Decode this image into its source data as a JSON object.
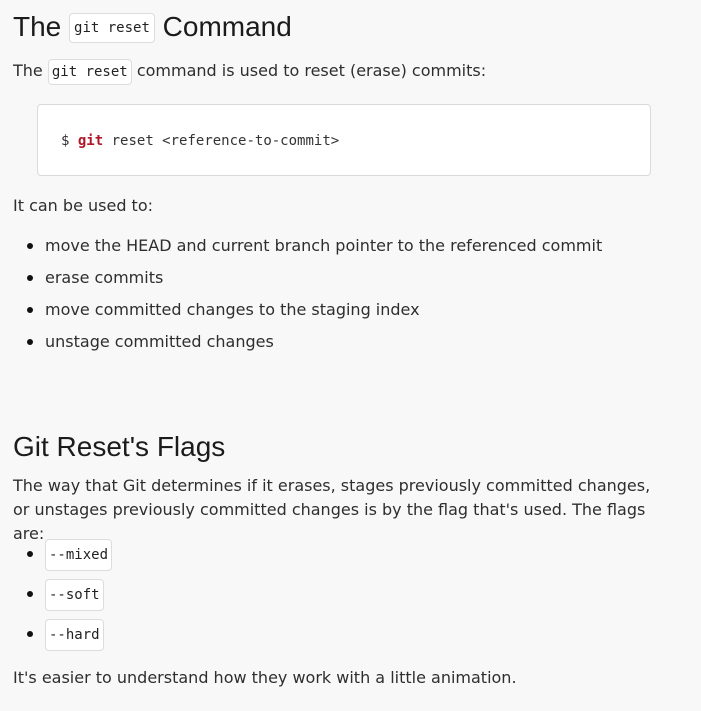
{
  "heading_command": {
    "before": "The",
    "code": "git reset",
    "after": "Command"
  },
  "intro": {
    "before": "The",
    "code": "git reset",
    "after": "command is used to reset (erase) commits:"
  },
  "codeblock": {
    "prompt": "$",
    "keyword": "git",
    "rest": "reset <reference-to-commit>"
  },
  "used_to": "It can be used to:",
  "uses": [
    "move the HEAD and current branch pointer to the referenced commit",
    "erase commits",
    "move committed changes to the staging index",
    "unstage committed changes"
  ],
  "heading_flags": "Git Reset's Flags",
  "flags_desc": "The way that Git determines if it erases, stages previously committed changes, or unstages previously committed changes is by the flag that's used. The flags are:",
  "flags": [
    "--mixed",
    "--soft",
    "--hard"
  ],
  "outro": "It's easier to understand how they work with a little animation."
}
